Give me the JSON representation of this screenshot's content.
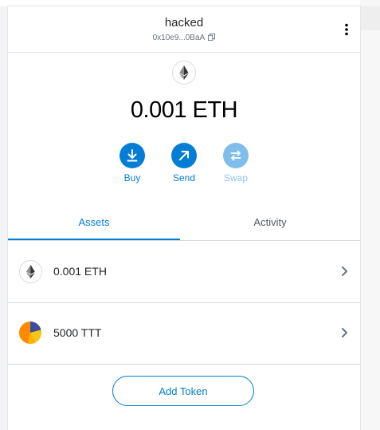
{
  "header": {
    "account_name": "hacked",
    "address": "0x10e9...0BaA"
  },
  "balance": {
    "amount": "0.001 ETH"
  },
  "actions": {
    "buy": "Buy",
    "send": "Send",
    "swap": "Swap"
  },
  "tabs": {
    "assets": "Assets",
    "activity": "Activity"
  },
  "assets": [
    {
      "amount": "0.001 ETH",
      "icon": "eth-icon"
    },
    {
      "amount": "5000 TTT",
      "icon": "ttt-token-icon"
    }
  ],
  "add_token_label": "Add Token",
  "colors": {
    "accent": "#037dd6",
    "accent_disabled": "#7fbeeb"
  }
}
